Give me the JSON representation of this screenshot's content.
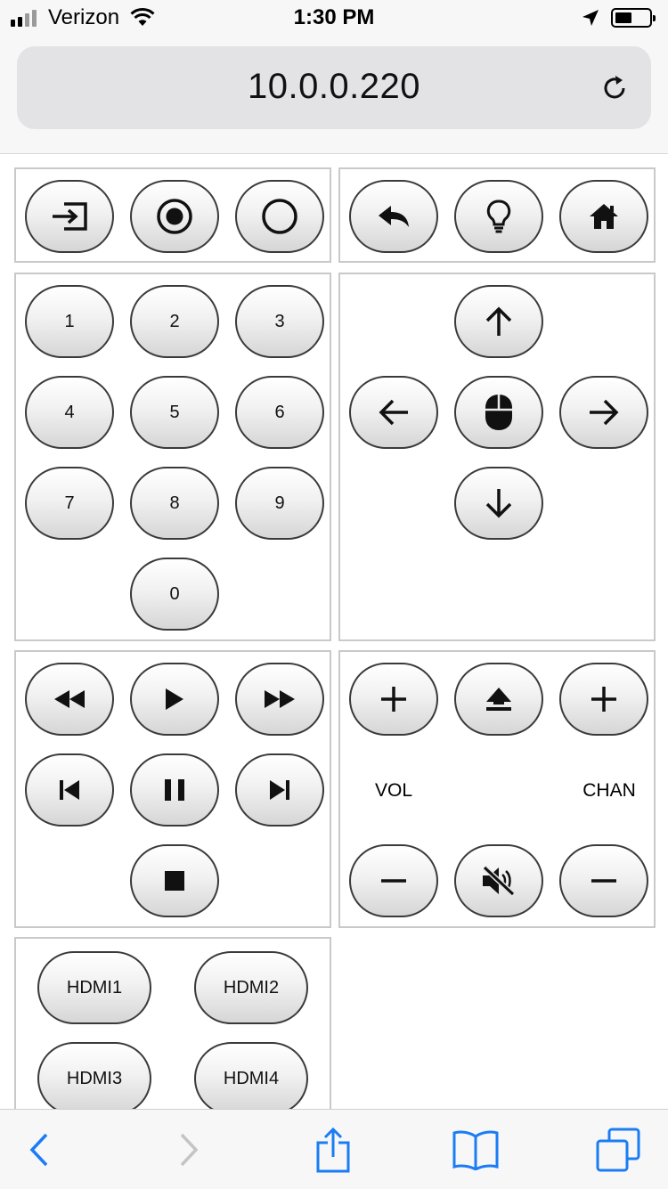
{
  "status": {
    "carrier": "Verizon",
    "time": "1:30 PM",
    "signal_bars": 4,
    "signal_active": 2,
    "battery_level": 0.4
  },
  "browser": {
    "url": "10.0.0.220"
  },
  "remote": {
    "numbers": [
      "1",
      "2",
      "3",
      "4",
      "5",
      "6",
      "7",
      "8",
      "9",
      "0"
    ],
    "vol_label": "VOL",
    "chan_label": "CHAN",
    "hdmi": [
      "HDMI1",
      "HDMI2",
      "HDMI3",
      "HDMI4"
    ]
  },
  "icons": {
    "top_left": [
      "input-icon",
      "record-dot-icon",
      "power-circle-icon"
    ],
    "top_right": [
      "back-reply-icon",
      "lightbulb-icon",
      "home-icon"
    ],
    "dpad": [
      "arrow-up-icon",
      "arrow-left-icon",
      "mouse-icon",
      "arrow-right-icon",
      "arrow-down-icon"
    ],
    "playback": [
      "rewind-icon",
      "play-icon",
      "fast-forward-icon",
      "skip-back-icon",
      "pause-icon",
      "skip-forward-icon",
      "stop-icon"
    ],
    "volume": [
      "vol-plus-icon",
      "eject-icon",
      "chan-plus-icon",
      "vol-minus-icon",
      "mute-icon",
      "chan-minus-icon"
    ],
    "toolbar": [
      "back-icon",
      "forward-icon",
      "share-icon",
      "bookmarks-icon",
      "tabs-icon"
    ]
  },
  "colors": {
    "ios_blue": "#1b7cf4",
    "disabled_gray": "#c4c4c8",
    "button_border": "#3a3a3a",
    "panel_border": "#c9c9c9"
  }
}
